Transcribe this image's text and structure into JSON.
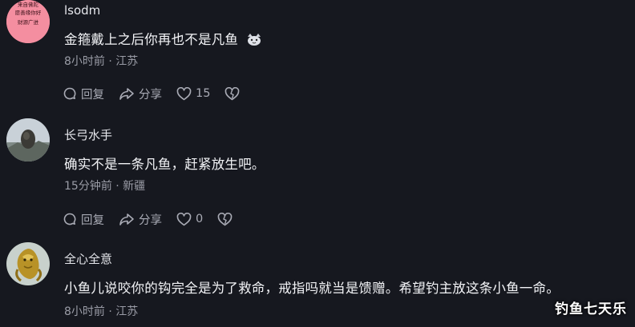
{
  "comments": [
    {
      "username": "lsodm",
      "avatar_text": [
        "来自佛陀",
        "愿善缘你好",
        "财源广进"
      ],
      "text": "金箍戴上之后你再也不是凡鱼",
      "emoji": "cat-emoji",
      "meta": "8小时前 · 江苏",
      "actions": {
        "reply": "回复",
        "share": "分享",
        "likes": "15"
      }
    },
    {
      "username": "长弓水手",
      "text": "确实不是一条凡鱼，赶紧放生吧。",
      "meta": "15分钟前 · 新疆",
      "actions": {
        "reply": "回复",
        "share": "分享",
        "likes": "0"
      }
    },
    {
      "username": "全心全意",
      "text": "小鱼儿说咬你的钩完全是为了救命，戒指吗就当是馈赠。希望钓主放这条小鱼一命。",
      "meta": "8小时前 · 江苏"
    }
  ],
  "watermark": "钓鱼七天乐",
  "colors": {
    "background": "#16181f",
    "text": "#f2f3f6",
    "muted": "#9a9ca6"
  }
}
